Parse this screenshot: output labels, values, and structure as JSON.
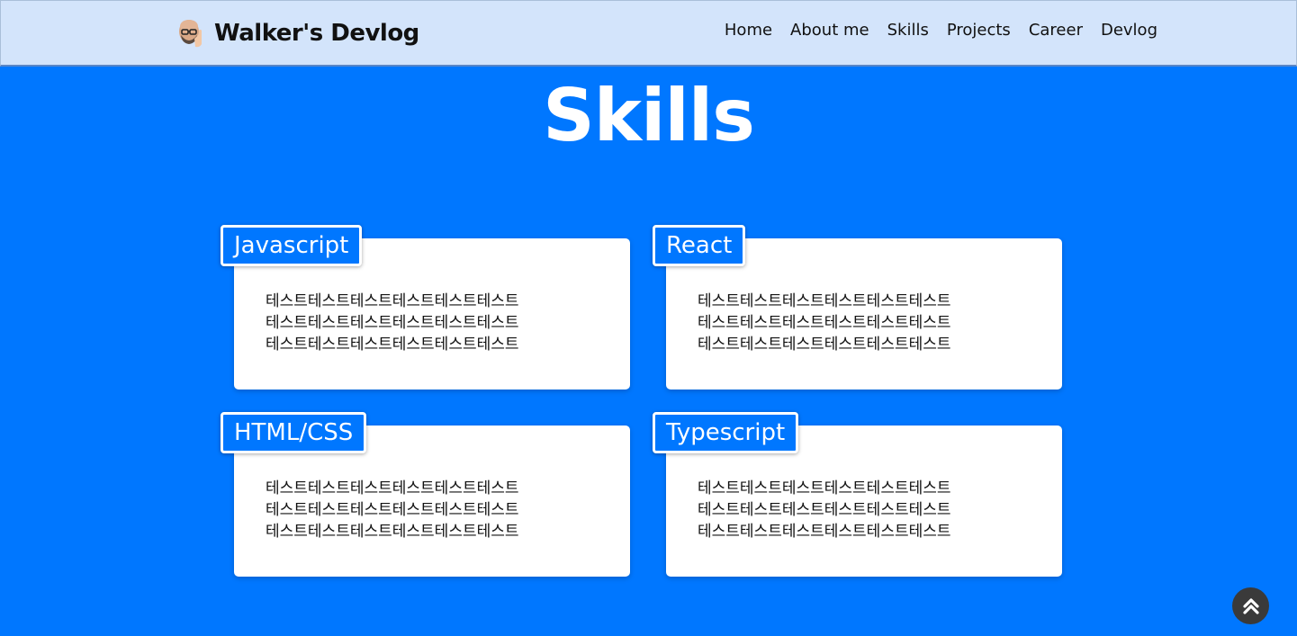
{
  "header": {
    "brand_title": "Walker's Devlog",
    "avatar_icon": "memoji-avatar-icon",
    "nav": [
      "Home",
      "About me",
      "Skills",
      "Projects",
      "Career",
      "Devlog"
    ]
  },
  "main": {
    "page_title": "Skills",
    "cards": [
      {
        "tag": "Javascript",
        "lines": [
          "테스트테스트테스트테스트테스트테스트",
          "테스트테스트테스트테스트테스트테스트",
          "테스트테스트테스트테스트테스트테스트"
        ]
      },
      {
        "tag": "React",
        "lines": [
          "테스트테스트테스트테스트테스트테스트",
          "테스트테스트테스트테스트테스트테스트",
          "테스트테스트테스트테스트테스트테스트"
        ]
      },
      {
        "tag": "HTML/CSS",
        "lines": [
          "테스트테스트테스트테스트테스트테스트",
          "테스트테스트테스트테스트테스트테스트",
          "테스트테스트테스트테스트테스트테스트"
        ]
      },
      {
        "tag": "Typescript",
        "lines": [
          "테스트테스트테스트테스트테스트테스트",
          "테스트테스트테스트테스트테스트테스트",
          "테스트테스트테스트테스트테스트테스트"
        ]
      }
    ]
  },
  "scroll_top": {
    "icon": "double-chevron-up-icon"
  },
  "colors": {
    "background": "#0077ff",
    "header_bg": "#d3e4fb",
    "card_bg": "#ffffff",
    "scroll_button": "#3a3a3a"
  }
}
